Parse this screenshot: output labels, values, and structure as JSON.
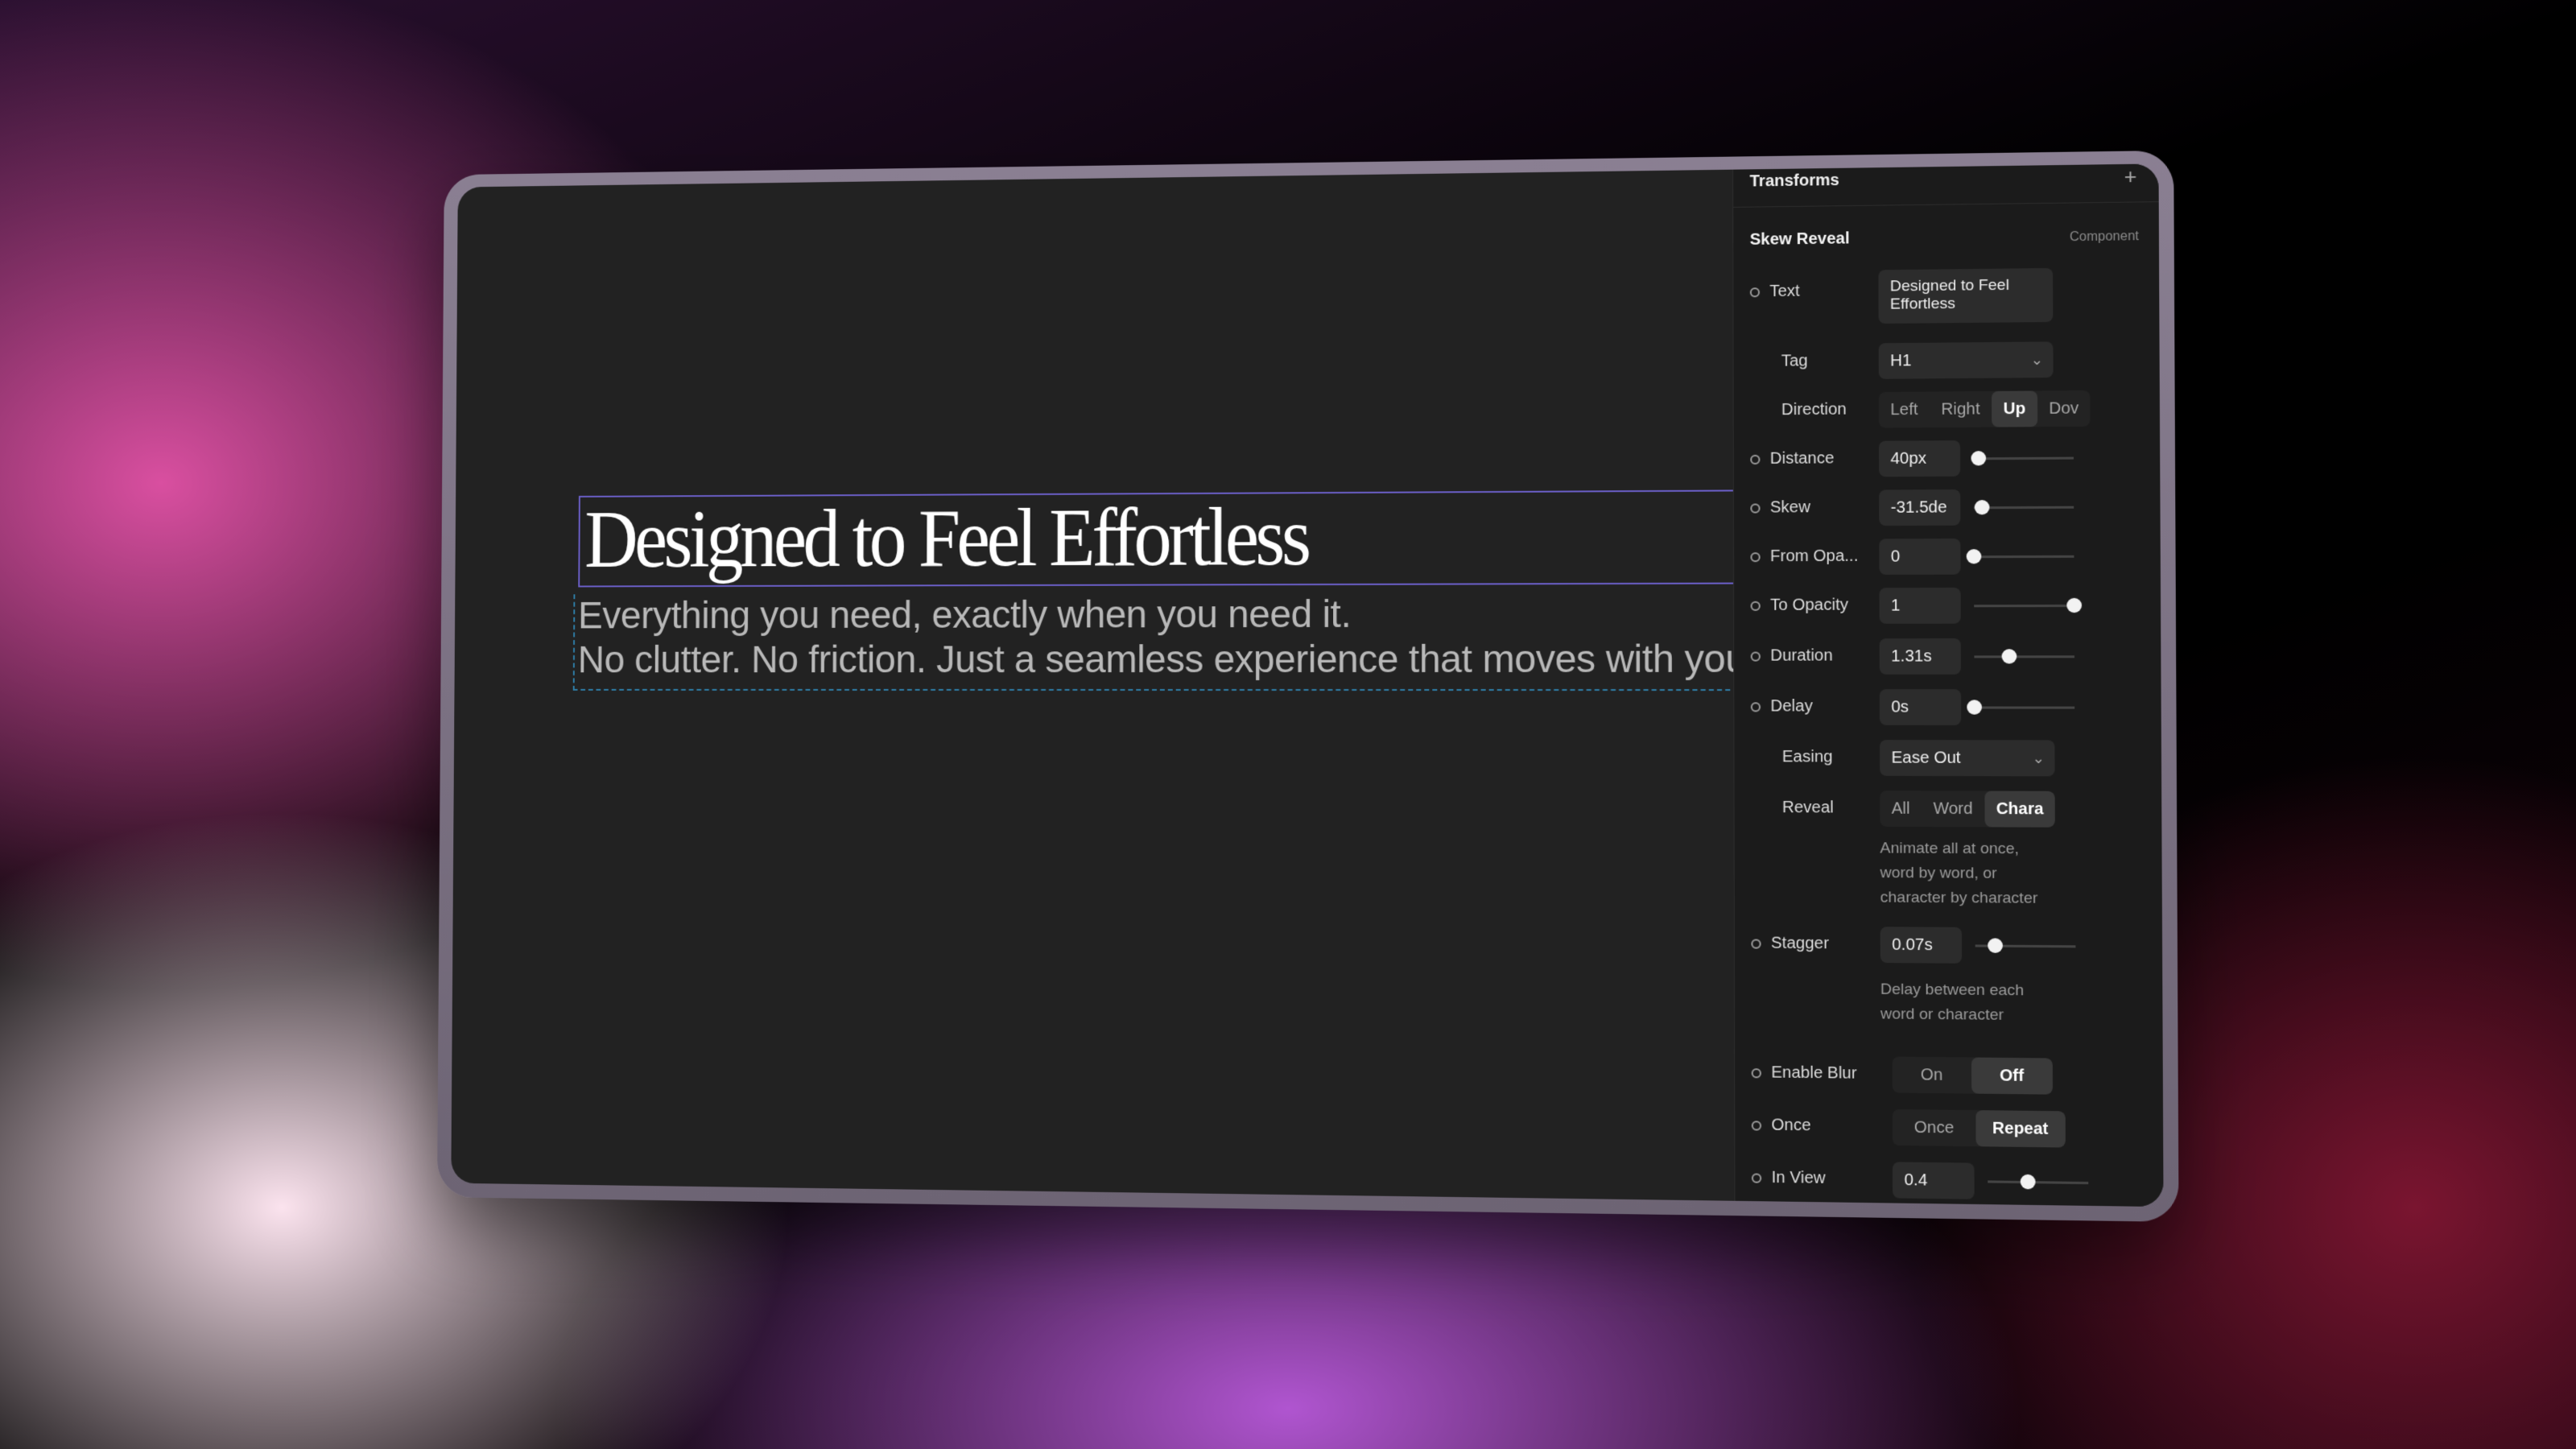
{
  "canvas": {
    "headline": "Designed to Feel Effortless",
    "body_line_1": "Everything you need, exactly when you need it.",
    "body_line_2": "No clutter. No friction. Just a seamless experience that moves with you"
  },
  "panel": {
    "title": "Transforms",
    "add_icon": "plus-icon",
    "section_title": "Skew Reveal",
    "section_type": "Component",
    "text": {
      "label": "Text",
      "value": "Designed to Feel Effortless"
    },
    "tag": {
      "label": "Tag",
      "value": "H1"
    },
    "direction": {
      "label": "Direction",
      "options": [
        "Left",
        "Right",
        "Up",
        "Dov"
      ],
      "selected": "Up"
    },
    "distance": {
      "label": "Distance",
      "value": "40px",
      "level": 0.05
    },
    "skew": {
      "label": "Skew",
      "value": "-31.5de",
      "level": 0.08
    },
    "from_opacity": {
      "label": "From Opa...",
      "value": "0",
      "level": 0.0
    },
    "to_opacity": {
      "label": "To Opacity",
      "value": "1",
      "level": 1.0
    },
    "duration": {
      "label": "Duration",
      "value": "1.31s",
      "level": 0.35
    },
    "delay": {
      "label": "Delay",
      "value": "0s",
      "level": 0.0
    },
    "easing": {
      "label": "Easing",
      "value": "Ease Out"
    },
    "reveal": {
      "label": "Reveal",
      "options": [
        "All",
        "Word",
        "Chara"
      ],
      "selected": "Chara",
      "help_1": "Animate all at once,",
      "help_2": "word by word, or",
      "help_3": "character by character"
    },
    "stagger": {
      "label": "Stagger",
      "value": "0.07s",
      "level": 0.2,
      "help_1": "Delay between each",
      "help_2": "word or character"
    },
    "enable_blur": {
      "label": "Enable Blur",
      "options": [
        "On",
        "Off"
      ],
      "selected": "Off"
    },
    "once": {
      "label": "Once",
      "options": [
        "Once",
        "Repeat"
      ],
      "selected": "Repeat"
    },
    "in_view": {
      "label": "In View",
      "value": "0.4",
      "level": 0.4
    }
  }
}
